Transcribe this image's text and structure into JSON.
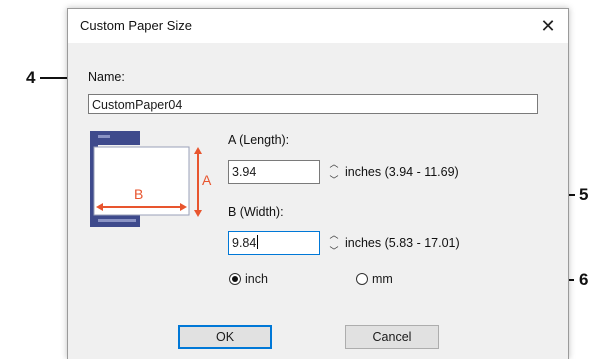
{
  "dialog": {
    "title": "Custom Paper Size",
    "close_icon": "close-icon"
  },
  "callouts": {
    "name": "4",
    "size_fields": "5",
    "units": "6"
  },
  "name_field": {
    "label": "Name:",
    "value": "CustomPaper04"
  },
  "diagram": {
    "icon": "paper-diagram-icon",
    "label_a": "A",
    "label_b": "B",
    "accent_color": "#e8552e",
    "tray_color": "#3e4a8c"
  },
  "length_field": {
    "label": "A (Length):",
    "value": "3.94",
    "range": "inches (3.94 - 11.69)"
  },
  "width_field": {
    "label": "B (Width):",
    "value": "9.84",
    "range": "inches (5.83 - 17.01)"
  },
  "units": {
    "inch_label": "inch",
    "mm_label": "mm",
    "selected": "inch"
  },
  "buttons": {
    "ok": "OK",
    "cancel": "Cancel"
  }
}
